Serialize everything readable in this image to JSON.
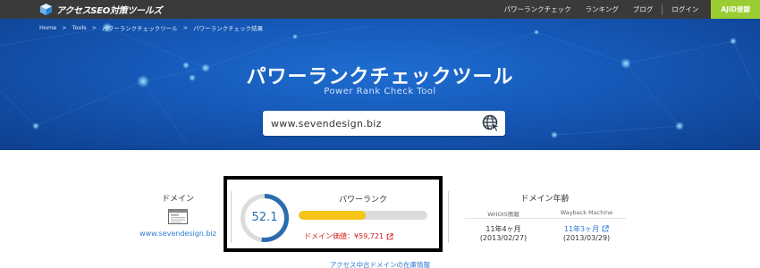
{
  "nav": {
    "logo_text": "アクセスSEO対策ツールズ",
    "items": [
      "パワーランクチェック",
      "ランキング",
      "ブログ",
      "ログイン"
    ],
    "cta": "AJID登録"
  },
  "breadcrumb": [
    "Home",
    "Tools",
    "パワーランクチェックツール",
    "パワーランクチェック結果"
  ],
  "breadcrumb_sep": ">",
  "hero": {
    "title": "パワーランクチェックツール",
    "subtitle": "Power Rank Check Tool"
  },
  "search": {
    "value": "www.sevendesign.biz"
  },
  "domain": {
    "label": "ドメイン",
    "link": "www.sevendesign.biz"
  },
  "power_rank": {
    "label": "パワーランク",
    "value": "52.1",
    "score": 52.1,
    "bar_fraction": 0.52,
    "domain_value": "ドメイン価値：¥59,721"
  },
  "domain_age": {
    "title": "ドメイン年齢",
    "whois_label": "WHOIS情報",
    "wayback_label": "Wayback Machine",
    "whois_age": "11年4ヶ月",
    "whois_date": "(2013/02/27)",
    "wayback_age": "11年3ヶ月",
    "wayback_date": "(2013/03/29)"
  },
  "bottom_link": "アクセス中古ドメインの在庫情報",
  "colors": {
    "hero_blue": "#1559b8",
    "nav_bg": "#3a3a3a",
    "cta_green": "#9acd32",
    "bar_yellow": "#f5c518",
    "gauge_blue": "#2b6cae",
    "link_blue": "#2a7ad5",
    "value_red": "#d41c1c"
  }
}
